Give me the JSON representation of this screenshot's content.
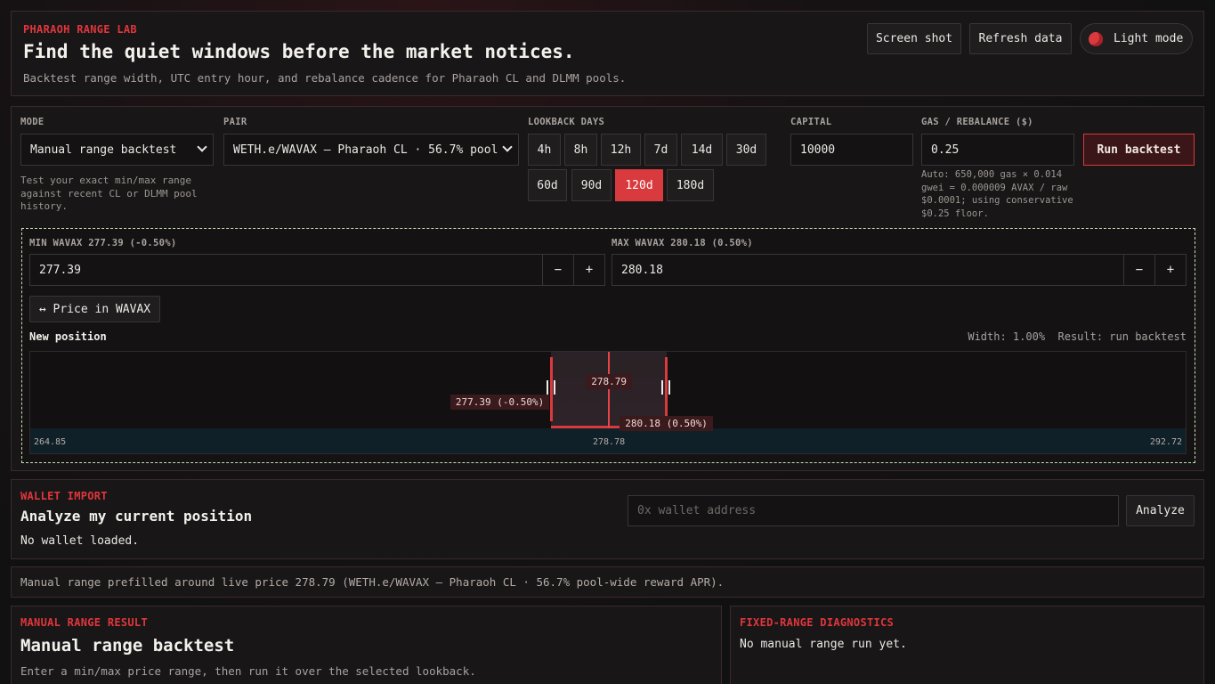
{
  "header": {
    "kicker": "PHARAOH RANGE LAB",
    "title": "Find the quiet windows before the market notices.",
    "subtitle": "Backtest range width, UTC entry hour, and rebalance cadence for Pharaoh CL and DLMM pools.",
    "screenshot_label": "Screen shot",
    "refresh_label": "Refresh data",
    "theme_label": "Light mode"
  },
  "controls": {
    "mode_label": "MODE",
    "mode_value": "Manual range backtest",
    "mode_help": "Test your exact min/max range against recent CL or DLMM pool history.",
    "pair_label": "PAIR",
    "pair_value": "WETH.e/WAVAX — Pharaoh CL · 56.7% pool",
    "lookback_label": "LOOKBACK DAYS",
    "lookback_options": [
      "4h",
      "8h",
      "12h",
      "7d",
      "14d",
      "30d",
      "60d",
      "90d",
      "120d",
      "180d"
    ],
    "lookback_selected": "120d",
    "capital_label": "CAPITAL",
    "capital_value": "10000",
    "gas_label": "GAS / REBALANCE ($)",
    "gas_value": "0.25",
    "gas_help": "Auto: 650,000 gas × 0.014 gwei = 0.000009 AVAX / raw $0.0001; using conservative $0.25 floor.",
    "run_label": "Run backtest"
  },
  "range": {
    "min_label": "MIN WAVAX 277.39 (-0.50%)",
    "min_value": "277.39",
    "max_label": "MAX WAVAX 280.18 (0.50%)",
    "max_value": "280.18",
    "minus": "−",
    "plus": "+",
    "toggle_label": "↔ Price in WAVAX",
    "position_title": "New position",
    "width_text": "Width: 1.00%",
    "result_text": "Result: run backtest",
    "axis_min": 264.85,
    "axis_max": 292.72,
    "axis_left_label": "264.85",
    "axis_mid_label": "278.78",
    "axis_right_label": "292.72",
    "current_price": 278.79,
    "current_label": "278.79",
    "range_min": 277.39,
    "range_max": 280.18,
    "min_tag": "277.39 (-0.50%)",
    "max_tag": "280.18 (0.50%)"
  },
  "wallet": {
    "kicker": "WALLET IMPORT",
    "title": "Analyze my current position",
    "status": "No wallet loaded.",
    "placeholder": "0x wallet address",
    "analyze_label": "Analyze"
  },
  "notice": "Manual range prefilled around live price 278.79 (WETH.e/WAVAX — Pharaoh CL · 56.7% pool-wide reward APR).",
  "result": {
    "kicker": "MANUAL RANGE RESULT",
    "title": "Manual range backtest",
    "text": "Enter a min/max price range, then run it over the selected lookback."
  },
  "diagnostics": {
    "kicker": "FIXED-RANGE DIAGNOSTICS",
    "text": "No manual range run yet."
  },
  "colors": {
    "accent": "#d93a3e",
    "background": "#141213",
    "panel": "#181617"
  }
}
